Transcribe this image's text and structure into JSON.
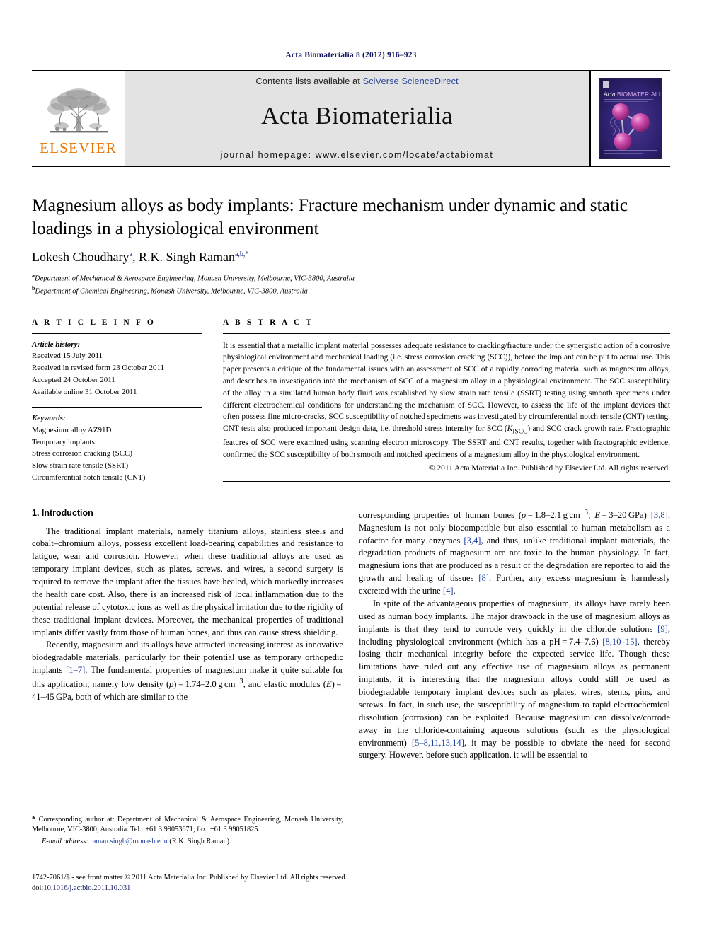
{
  "running_head": "Acta Biomaterialia 8 (2012) 916–923",
  "masthead": {
    "publisher_logo_text": "ELSEVIER",
    "contents_prefix": "Contents lists available at ",
    "contents_link": "SciVerse ScienceDirect",
    "journal_name": "Acta Biomaterialia",
    "homepage_line": "journal homepage: www.elsevier.com/locate/actabiomat",
    "cover": {
      "title_acta": "Acta",
      "title_biomaterialia": "BIOMATERIALIA",
      "subtitle": "An International Journal of Functional Biomaterials in Biomaterials"
    }
  },
  "article": {
    "title": "Magnesium alloys as body implants: Fracture mechanism under dynamic and static loadings in a physiological environment",
    "authors_html": "Lokesh Choudhary<sup>a</sup>, R.K. Singh Raman<sup>a,b,</sup><sup>*</sup>",
    "affiliation_a": "Department of Mechanical & Aerospace Engineering, Monash University, Melbourne, VIC-3800, Australia",
    "affiliation_b": "Department of Chemical Engineering, Monash University, Melbourne, VIC-3800, Australia"
  },
  "article_info": {
    "heading": "A R T I C L E   I N F O",
    "history_label": "Article history:",
    "history": [
      "Received 15 July 2011",
      "Received in revised form 23 October 2011",
      "Accepted 24 October 2011",
      "Available online 31 October 2011"
    ],
    "keywords_label": "Keywords:",
    "keywords": [
      "Magnesium alloy AZ91D",
      "Temporary implants",
      "Stress corrosion cracking (SCC)",
      "Slow strain rate tensile (SSRT)",
      "Circumferential notch tensile (CNT)"
    ]
  },
  "abstract": {
    "heading": "A B S T R A C T",
    "text_html": "It is essential that a metallic implant material possesses adequate resistance to cracking/fracture under the synergistic action of a corrosive physiological environment and mechanical loading (i.e. stress corrosion cracking (SCC)), before the implant can be put to actual use. This paper presents a critique of the fundamental issues with an assessment of SCC of a rapidly corroding material such as magnesium alloys, and describes an investigation into the mechanism of SCC of a magnesium alloy in a physiological environment. The SCC susceptibility of the alloy in a simulated human body fluid was established by slow strain rate tensile (SSRT) testing using smooth specimens under different electrochemical conditions for understanding the mechanism of SCC. However, to assess the life of the implant devices that often possess fine micro-cracks, SCC susceptibility of notched specimens was investigated by circumferential notch tensile (CNT) testing. CNT tests also produced important design data, i.e. threshold stress intensity for SCC (<i>K</i><sub>ISCC</sub>) and SCC crack growth rate. Fractographic features of SCC were examined using scanning electron microscopy. The SSRT and CNT results, together with fractographic evidence, confirmed the SCC susceptibility of both smooth and notched specimens of a magnesium alloy in the physiological environment.",
    "copyright": "© 2011 Acta Materialia Inc. Published by Elsevier Ltd. All rights reserved."
  },
  "body": {
    "section_title": "1. Introduction",
    "left_paragraphs_html": [
      "The traditional implant materials, namely titanium alloys, stainless steels and cobalt–chromium alloys, possess excellent load-bearing capabilities and resistance to fatigue, wear and corrosion. However, when these traditional alloys are used as temporary implant devices, such as plates, screws, and wires, a second surgery is required to remove the implant after the tissues have healed, which markedly increases the health care cost. Also, there is an increased risk of local inflammation due to the potential release of cytotoxic ions as well as the physical irritation due to the rigidity of these traditional implant devices. Moreover, the mechanical properties of traditional implants differ vastly from those of human bones, and thus can cause stress shielding.",
      "Recently, magnesium and its alloys have attracted increasing interest as innovative biodegradable materials, particularly for their potential use as temporary orthopedic implants <span class=\"ref\">[1–7]</span>. The fundamental properties of magnesium make it quite suitable for this application, namely low density (<i>ρ</i>)&#8201;=&#8201;1.74–2.0&#8201;g&#8201;cm<sup>−3</sup>, and elastic modulus (<i>E</i>)&#8201;=&#8201;41–45&#8201;GPa, both of which are similar to the"
    ],
    "right_paragraphs_html": [
      "corresponding properties of human bones (<i>ρ</i>&#8201;=&#8201;1.8–2.1&#8201;g&#8201;cm<sup>−3</sup>; <i>E</i>&#8201;=&#8201;3–20&#8201;GPa) <span class=\"ref\">[3,8]</span>. Magnesium is not only biocompatible but also essential to human metabolism as a cofactor for many enzymes <span class=\"ref\">[3,4]</span>, and thus, unlike traditional implant materials, the degradation products of magnesium are not toxic to the human physiology. In fact, magnesium ions that are produced as a result of the degradation are reported to aid the growth and healing of tissues <span class=\"ref\">[8]</span>. Further, any excess magnesium is harmlessly excreted with the urine <span class=\"ref\">[4]</span>.",
      "In spite of the advantageous properties of magnesium, its alloys have rarely been used as human body implants. The major drawback in the use of magnesium alloys as implants is that they tend to corrode very quickly in the chloride solutions <span class=\"ref\">[9]</span>, including physiological environment (which has a pH&#8201;=&#8201;7.4–7.6) <span class=\"ref\">[8,10–15]</span>, thereby losing their mechanical integrity before the expected service life. Though these limitations have ruled out any effective use of magnesium alloys as permanent implants, it is interesting that the magnesium alloys could still be used as biodegradable temporary implant devices such as plates, wires, stents, pins, and screws. In fact, in such use, the susceptibility of magnesium to rapid electrochemical dissolution (corrosion) can be exploited. Because magnesium can dissolve/corrode away in the chloride-containing aqueous solutions (such as the physiological environment) <span class=\"ref\">[5–8,11,13,14]</span>, it may be possible to obviate the need for second surgery. However, before such application, it will be essential to"
    ]
  },
  "footnote": {
    "corresponding_html": "<b>*</b> Corresponding author at: Department of Mechanical &amp; Aerospace Engineering, Monash University, Melbourne, VIC-3800, Australia. Tel.: +61 3 99053671; fax: +61 3 99051825.",
    "email_label": "E-mail address:",
    "email": "raman.singh@monash.edu",
    "email_suffix": "(R.K. Singh Raman)."
  },
  "page_footer": {
    "line1": "1742-7061/$ - see front matter © 2011 Acta Materialia Inc. Published by Elsevier Ltd. All rights reserved.",
    "doi_label": "doi:",
    "doi": "10.1016/j.actbio.2011.10.031"
  }
}
